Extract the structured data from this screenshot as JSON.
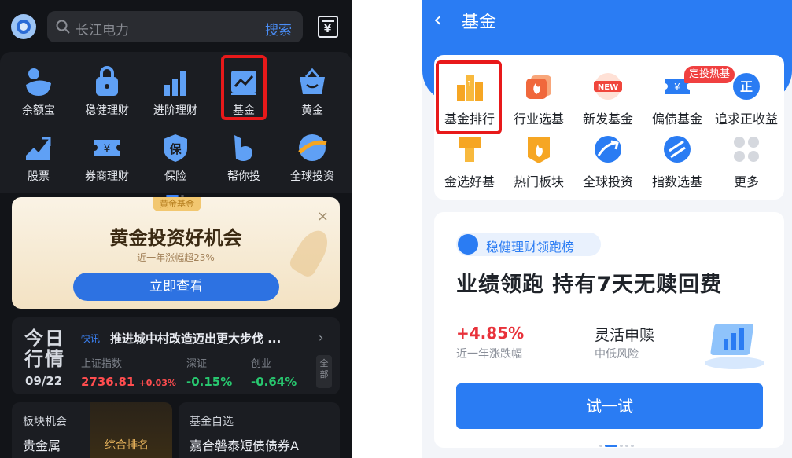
{
  "left": {
    "search": {
      "placeholder": "长江电力",
      "button": "搜索"
    },
    "grid": [
      {
        "label": "余额宝",
        "icon": "yuebao-icon"
      },
      {
        "label": "稳健理财",
        "icon": "lock-bag-icon"
      },
      {
        "label": "进阶理财",
        "icon": "bar-chart-icon"
      },
      {
        "label": "基金",
        "icon": "fund-chart-icon"
      },
      {
        "label": "黄金",
        "icon": "gold-basket-icon"
      },
      {
        "label": "股票",
        "icon": "stock-trend-icon"
      },
      {
        "label": "券商理财",
        "icon": "yen-ticket-icon"
      },
      {
        "label": "保险",
        "icon": "shield-icon"
      },
      {
        "label": "帮你投",
        "icon": "b-logo-icon"
      },
      {
        "label": "全球投资",
        "icon": "globe-icon"
      }
    ],
    "promo": {
      "tag": "黄金基金",
      "title": "黄金投资好机会",
      "subtitle": "近一年涨幅超23%",
      "button": "立即查看",
      "close": "×"
    },
    "market": {
      "day_label_1": "今日",
      "day_label_2": "行情",
      "date": "09/22",
      "flash": "快讯",
      "headline": "推进城中村改造迈出更大步伐 ...",
      "all": "全部",
      "indices": [
        {
          "name": "上证指数",
          "value": "2736.81",
          "change": "+0.03%",
          "color": "#ff4d4f"
        },
        {
          "name": "深证",
          "value": "-0.15%",
          "color": "#28c76f"
        },
        {
          "name": "创业",
          "value": "-0.64%",
          "color": "#28c76f"
        }
      ]
    },
    "bottom": {
      "sector_title": "板块机会",
      "sector_value": "贵金属",
      "rank_label": "综合排名",
      "watch_title": "基金自选",
      "watch_value": "嘉合磐泰短债债券A"
    }
  },
  "right": {
    "title": "基金",
    "hot_tag": "定投热基",
    "grid": [
      {
        "label": "基金排行",
        "icon": "ranking-bars-icon"
      },
      {
        "label": "行业选基",
        "icon": "industry-flame-icon"
      },
      {
        "label": "新发基金",
        "icon": "new-badge-icon"
      },
      {
        "label": "偏债基金",
        "icon": "bond-ticket-icon"
      },
      {
        "label": "追求正收益",
        "icon": "positive-return-icon"
      },
      {
        "label": "金选好基",
        "icon": "gold-pick-icon"
      },
      {
        "label": "热门板块",
        "icon": "hot-sector-icon"
      },
      {
        "label": "全球投资",
        "icon": "globe-icon"
      },
      {
        "label": "指数选基",
        "icon": "index-icon"
      },
      {
        "label": "更多",
        "icon": "more-grid-icon"
      }
    ],
    "card": {
      "badge": "稳健理财领跑榜",
      "headline": "业绩领跑 持有7天无赎回费",
      "return_value": "+4.85%",
      "return_label": "近一年涨跌幅",
      "feature": "灵活申赎",
      "risk": "中低风险",
      "button": "试一试"
    }
  }
}
